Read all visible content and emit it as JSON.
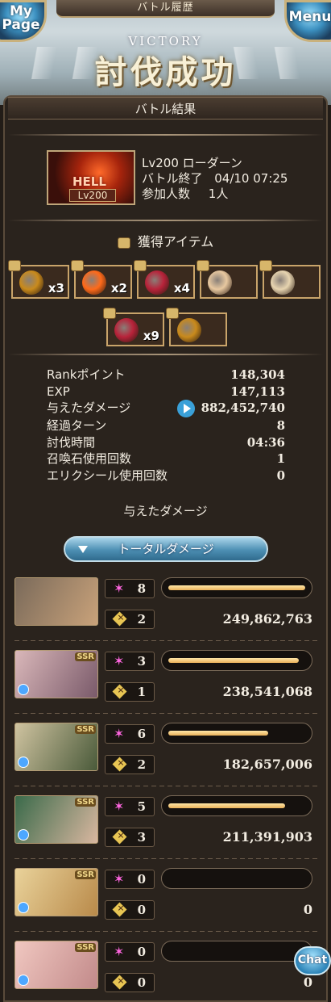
{
  "header": {
    "title": "バトル履歴",
    "mypage_label": "My Page",
    "menu_label": "Menu",
    "victory_en": "VICTORY",
    "victory_jp": "討伐成功"
  },
  "result_title": "バトル結果",
  "quest": {
    "name": "Lv200 ローダーン",
    "end_label": "バトル終了",
    "end_time": "04/10 07:25",
    "participants_label": "参加人数",
    "participants": "1人",
    "thumb_badge": "HELL",
    "thumb_level": "Lv200"
  },
  "items_title": "獲得アイテム",
  "items": [
    {
      "icon": "gold-coin-icon",
      "count": "x3",
      "color": "#c98a1c"
    },
    {
      "icon": "fire-orb-icon",
      "count": "x2",
      "color": "#ff6a1a"
    },
    {
      "icon": "red-pouch-icon",
      "count": "x4",
      "color": "#b8233a"
    },
    {
      "icon": "character-card-icon",
      "count": "",
      "color": "#e8c8a0"
    },
    {
      "icon": "scroll-icon",
      "count": "",
      "color": "#e7d4b0"
    },
    {
      "icon": "red-pouch-icon",
      "count": "x9",
      "color": "#b8233a"
    },
    {
      "icon": "gold-coin-icon",
      "count": "",
      "color": "#c98a1c"
    }
  ],
  "stats": [
    {
      "label": "Rankポイント",
      "value": "148,304"
    },
    {
      "label": "EXP",
      "value": "147,113"
    },
    {
      "label": "与えたダメージ",
      "value": "882,452,740"
    },
    {
      "label": "経過ターン",
      "value": "8"
    },
    {
      "label": "討伐時間",
      "value": "04:36"
    },
    {
      "label": "召喚石使用回数",
      "value": "1"
    },
    {
      "label": "エリクシール使用回数",
      "value": "0"
    }
  ],
  "damage_label": "与えたダメージ",
  "total_button": "トータルダメージ",
  "characters": [
    {
      "skills": "8",
      "charge": "2",
      "damage": "249,862,763",
      "fill": 1.0,
      "ssr": false,
      "colors": [
        "#7a6a5a",
        "#c9a27a"
      ]
    },
    {
      "skills": "3",
      "charge": "1",
      "damage": "238,541,068",
      "fill": 0.95,
      "ssr": true,
      "colors": [
        "#d9b7b9",
        "#7a5a6a"
      ]
    },
    {
      "skills": "6",
      "charge": "2",
      "damage": "182,657,006",
      "fill": 0.73,
      "ssr": true,
      "colors": [
        "#cfc3a0",
        "#4a5a3a"
      ]
    },
    {
      "skills": "5",
      "charge": "3",
      "damage": "211,391,903",
      "fill": 0.85,
      "ssr": true,
      "colors": [
        "#3a6a4a",
        "#d9b7a0"
      ]
    },
    {
      "skills": "0",
      "charge": "0",
      "damage": "0",
      "fill": 0,
      "ssr": true,
      "colors": [
        "#e9d29a",
        "#b98a4a"
      ]
    },
    {
      "skills": "0",
      "charge": "0",
      "damage": "0",
      "fill": 0,
      "ssr": true,
      "colors": [
        "#f0c7c0",
        "#c28a8a"
      ]
    }
  ],
  "chat_label": "Chat"
}
